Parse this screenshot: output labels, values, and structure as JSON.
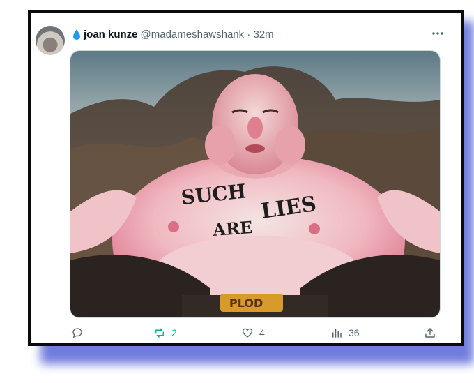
{
  "post": {
    "author_name": "joan kunze",
    "handle_time": "@madameshawshank · 32m",
    "more_icon": "more-horizontal-icon",
    "media_lettering": [
      "SUCH ARE LIES",
      "PLOD"
    ],
    "actions": {
      "reply_icon": "reply-icon",
      "retweet_icon": "retweet-icon",
      "retweet_count": "2",
      "like_icon": "heart-icon",
      "like_count": "4",
      "views_icon": "bar-chart-icon",
      "views_count": "36",
      "share_icon": "share-icon"
    }
  },
  "colors": {
    "frame_border": "#0b0b0b",
    "shadow": "#5a66d6",
    "retweet_green": "#00ba7c",
    "drop_blue": "#1d9bf0",
    "muted_text": "#536471"
  }
}
